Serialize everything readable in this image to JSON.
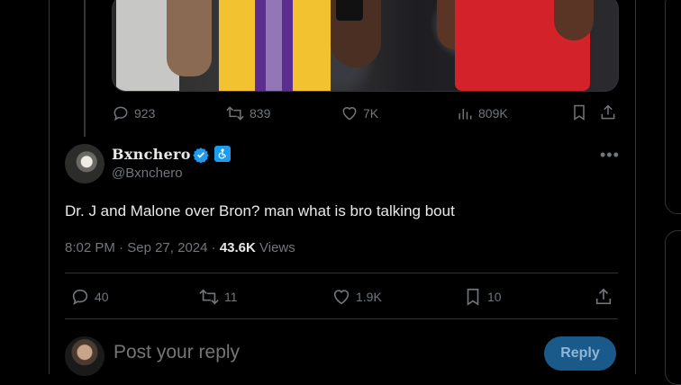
{
  "parent_tweet": {
    "stats": {
      "replies": "923",
      "reposts": "839",
      "likes": "7K",
      "views": "809K"
    }
  },
  "tweet": {
    "author_name": "Bxnchero",
    "handle": "@Bxnchero",
    "text": "Dr. J and Malone over Bron? man what is bro talking bout",
    "time": "8:02 PM",
    "date": "Sep 27, 2024",
    "views_count": "43.6K",
    "views_label": "Views",
    "stats": {
      "replies": "40",
      "reposts": "11",
      "likes": "1.9K",
      "bookmarks": "10"
    }
  },
  "reply_box": {
    "placeholder": "Post your reply",
    "button_label": "Reply"
  },
  "colors": {
    "background": "#000000",
    "text": "#e7e9ea",
    "muted": "#71767b",
    "accent": "#1d9bf0",
    "divider": "#2f3336"
  }
}
